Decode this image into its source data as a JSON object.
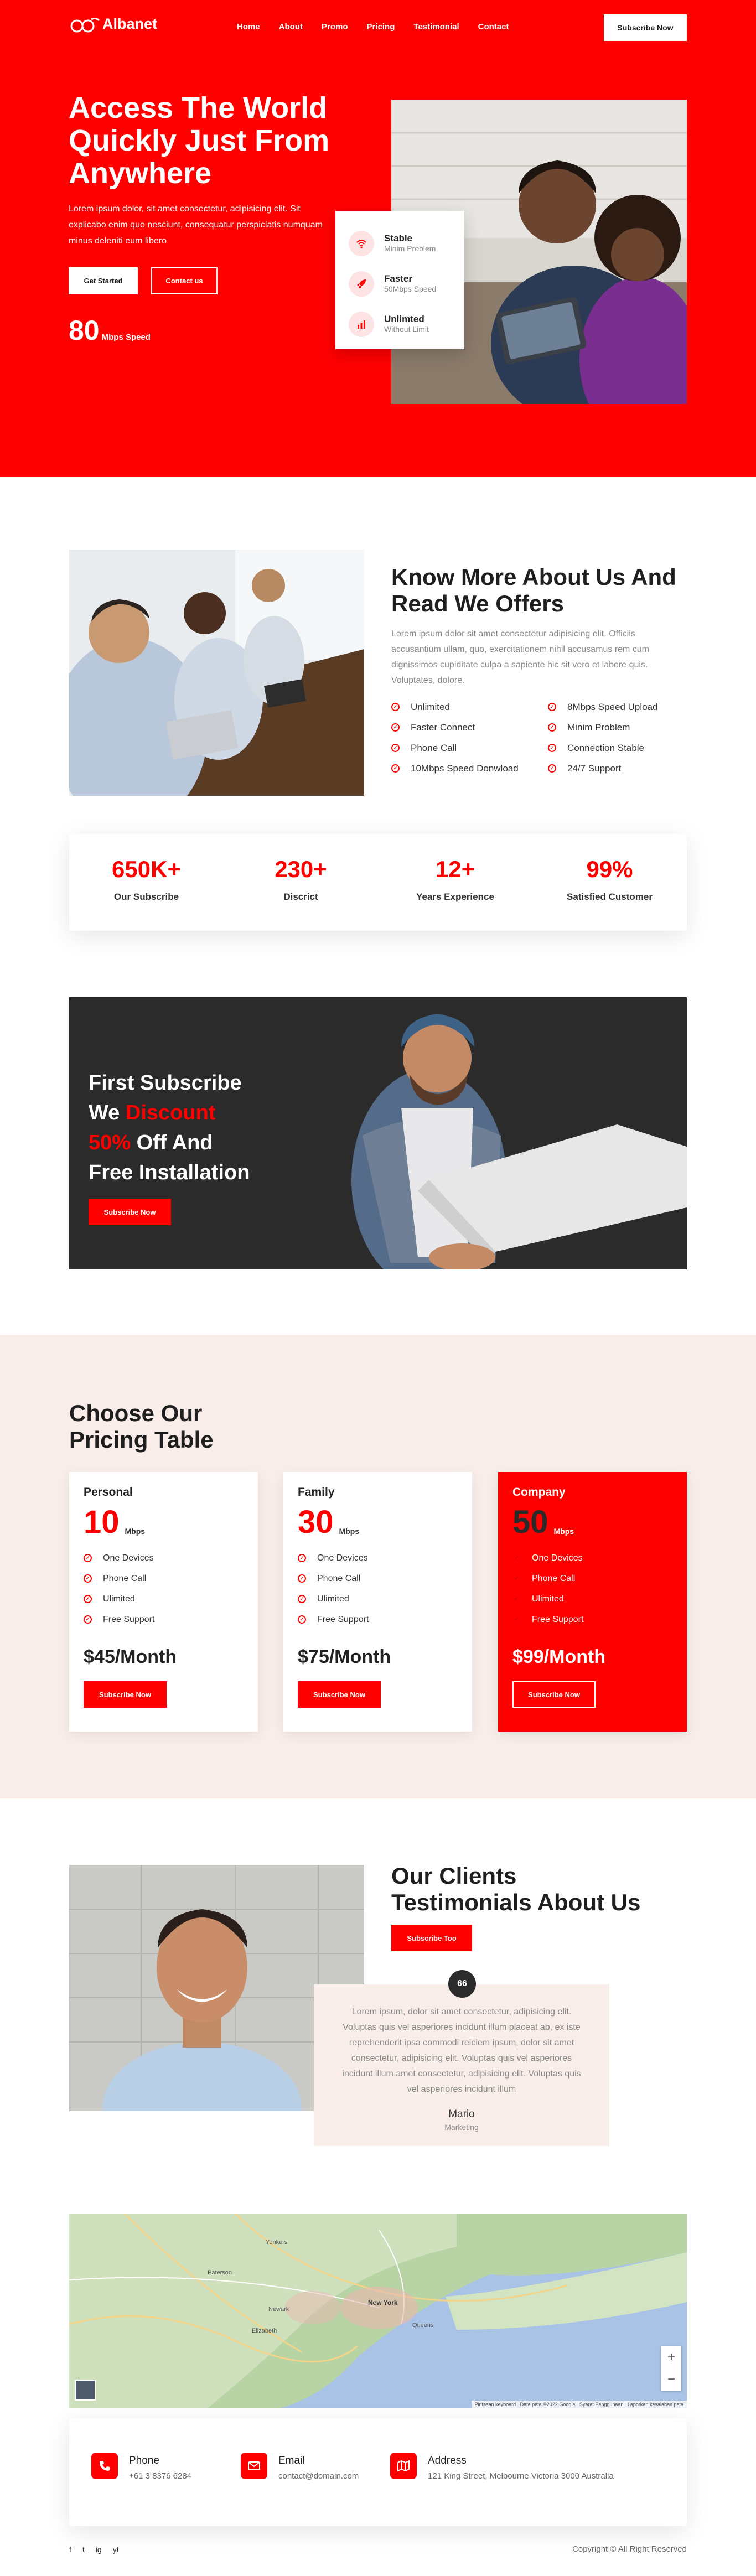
{
  "brand": {
    "name": "Albanet",
    "accent": "#ff0000"
  },
  "nav": {
    "items": [
      "Home",
      "About",
      "Promo",
      "Pricing",
      "Testimonial",
      "Contact"
    ],
    "cta": "Subscribe Now"
  },
  "hero": {
    "title": "Access The World Quickly Just From Anywhere",
    "text": "Lorem ipsum dolor, sit amet consectetur, adipisicing elit. Sit explicabo enim quo nesciunt, consequatur perspiciatis numquam minus deleniti eum libero",
    "btn_primary": "Get Started",
    "btn_secondary": "Contact us",
    "speed_value": "80",
    "speed_unit": "Mbps Speed",
    "features": [
      {
        "icon": "wifi-icon",
        "title": "Stable",
        "sub": "Minim Problem"
      },
      {
        "icon": "rocket-icon",
        "title": "Faster",
        "sub": "50Mbps Speed"
      },
      {
        "icon": "chart-icon",
        "title": "Unlimted",
        "sub": "Without Limit"
      }
    ]
  },
  "about": {
    "title": "Know More About Us And Read We Offers",
    "text": "Lorem ipsum dolor sit amet consectetur adipisicing elit. Officiis accusantium ullam, quo, exercitationem nihil accusamus rem cum dignissimos cupiditate culpa a sapiente hic sit vero et labore quis. Voluptates, dolore.",
    "left": [
      "Unlimited",
      "Faster Connect",
      "Phone Call",
      "10Mbps Speed Donwload"
    ],
    "right": [
      "8Mbps Speed Upload",
      "Minim Problem",
      "Connection Stable",
      "24/7 Support"
    ]
  },
  "stats": [
    {
      "value": "650K+",
      "label": "Our Subscribe"
    },
    {
      "value": "230+",
      "label": "Discrict"
    },
    {
      "value": "12+",
      "label": "Years Experience"
    },
    {
      "value": "99%",
      "label": "Satisfied Customer"
    }
  ],
  "promo": {
    "line1": "First Subscribe",
    "line2a": "We ",
    "line2b": "Discount",
    "line3a": "50%",
    "line3b": " Off And",
    "line4": "Free Installation",
    "btn": "Subscribe Now"
  },
  "pricing": {
    "title": "Choose Our Pricing Table",
    "plans": [
      {
        "name": "Personal",
        "speed": "10",
        "unit": "Mbps",
        "features": [
          "One Devices",
          "Phone Call",
          "Ulimited",
          "Free Support"
        ],
        "price": "$45/Month",
        "btn": "Subscribe Now"
      },
      {
        "name": "Family",
        "speed": "30",
        "unit": "Mbps",
        "features": [
          "One Devices",
          "Phone Call",
          "Ulimited",
          "Free Support"
        ],
        "price": "$75/Month",
        "btn": "Subscribe Now"
      },
      {
        "name": "Company",
        "speed": "50",
        "unit": "Mbps",
        "features": [
          "One Devices",
          "Phone Call",
          "Ulimited",
          "Free Support"
        ],
        "price": "$99/Month",
        "btn": "Subscribe Now"
      }
    ]
  },
  "testimonial": {
    "title": "Our Clients Testimonials About Us",
    "btn": "Subscribe Too",
    "quote_mark": "66",
    "text": "Lorem ipsum, dolor sit amet consectetur, adipisicing elit. Voluptas quis vel asperiores incidunt illum placeat ab, ex iste reprehenderit ipsa commodi reiciem ipsum, dolor sit amet consectetur, adipisicing elit. Voluptas quis vel asperiores incidunt illum amet consectetur, adipisicing elit. Voluptas quis vel asperiores incidunt illum",
    "name": "Mario",
    "role": "Marketing"
  },
  "map": {
    "places": [
      "Yonkers",
      "Newark",
      "New York",
      "Paterson",
      "Elizabeth",
      "Queens"
    ],
    "zoom_in": "+",
    "zoom_out": "−",
    "attribution": "Pintasan keyboard   Data peta ©2022 Google   Syarat Penggunaan   Laporkan kesalahan peta"
  },
  "contact": [
    {
      "icon": "phone-icon",
      "title": "Phone",
      "value": "+61 3 8376 6284"
    },
    {
      "icon": "mail-icon",
      "title": "Email",
      "value": "contact@domain.com"
    },
    {
      "icon": "map-icon",
      "title": "Address",
      "value": "121 King Street, Melbourne Victoria 3000 Australia"
    }
  ],
  "footer": {
    "social": [
      "f",
      "t",
      "ig",
      "yt"
    ],
    "copyright": "Copyright © All Right Reserved"
  }
}
